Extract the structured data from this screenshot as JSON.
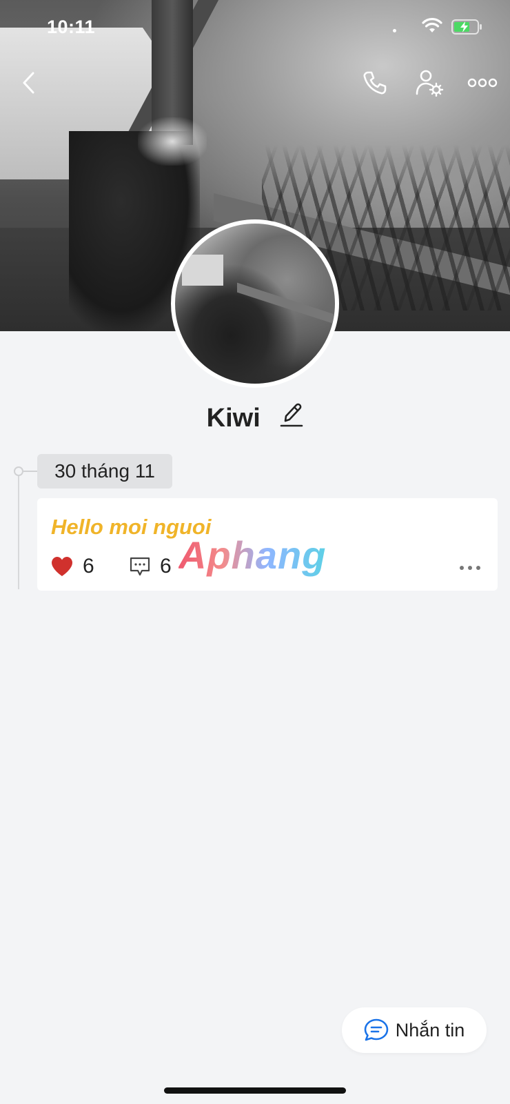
{
  "status_bar": {
    "time": "10:11"
  },
  "profile": {
    "name": "Kiwi"
  },
  "timeline": {
    "date_label": "30 tháng 11",
    "post": {
      "text": "Hello moi nguoi",
      "likes": "6",
      "comments": "6"
    }
  },
  "watermark": "Aphang",
  "actions": {
    "message_label": "Nhắn tin"
  },
  "colors": {
    "accent_blue": "#1a73e8",
    "post_text": "#f0b429",
    "like_red": "#d0312d"
  },
  "icons": [
    "back-icon",
    "phone-icon",
    "user-settings-icon",
    "more-icon",
    "edit-icon",
    "heart-icon",
    "comment-icon",
    "message-icon"
  ]
}
